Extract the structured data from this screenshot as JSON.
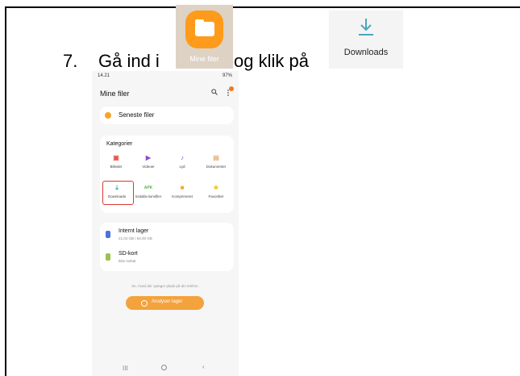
{
  "instruction": {
    "step_number": "7.",
    "text_before": "Gå ind i",
    "text_after": "og klik på"
  },
  "app_icon": {
    "label": "Mine filer",
    "color": "#ff9b1a"
  },
  "downloads_crop": {
    "label": "Downloads",
    "icon": "download-icon",
    "color": "#4aa8b9"
  },
  "phone": {
    "status_time": "14.21",
    "status_right": "97%",
    "app_title": "Mine filer",
    "recent": {
      "label": "Seneste filer"
    },
    "categories": {
      "title": "Kategorier",
      "items": [
        {
          "label": "Billeder",
          "glyph": "▣",
          "color": "#e8534b"
        },
        {
          "label": "Videoer",
          "glyph": "▶",
          "color": "#8e4cc7"
        },
        {
          "label": "Lyd",
          "glyph": "♪",
          "color": "#4a74d9"
        },
        {
          "label": "Dokumenter",
          "glyph": "▤",
          "color": "#e8b07a"
        },
        {
          "label": "Downloads",
          "glyph": "⤓",
          "color": "#4aa8b9"
        },
        {
          "label": "Installa-tionsfiler",
          "glyph": "APK",
          "color": "#58b34a"
        },
        {
          "label": "Komprimeret",
          "glyph": "■",
          "color": "#f5a623"
        },
        {
          "label": "Favoritter",
          "glyph": "★",
          "color": "#f5c018"
        }
      ]
    },
    "storage": [
      {
        "name": "Internt lager",
        "sub": "21,03 GB / 64,00 GB",
        "color": "#4a74d9"
      },
      {
        "name": "SD-kort",
        "sub": "Ikke indsat",
        "color": "#9bc34a"
      }
    ],
    "hint": "Se, hvad der optager plads på din telefon.",
    "analyze_label": "Analyser lager",
    "accent": "#f4a23c"
  }
}
